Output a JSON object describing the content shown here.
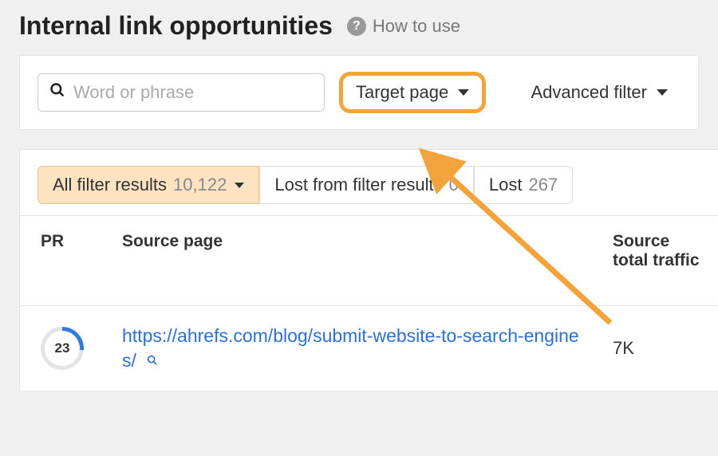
{
  "header": {
    "title": "Internal link opportunities",
    "help_label": "How to use"
  },
  "filters": {
    "search_placeholder": "Word or phrase",
    "target_dropdown_label": "Target page",
    "advanced_filter_label": "Advanced filter"
  },
  "tabs": {
    "all": {
      "label": "All filter results",
      "count": "10,122"
    },
    "lost_filter": {
      "label": "Lost from filter results",
      "count": "0"
    },
    "lost": {
      "label": "Lost",
      "count": "267"
    }
  },
  "table": {
    "columns": {
      "pr": "PR",
      "source_page": "Source page",
      "source_total_traffic": "Source total traffic"
    },
    "rows": [
      {
        "pr": "23",
        "url": "https://ahrefs.com/blog/submit-website-to-search-engines/",
        "traffic": "7K"
      }
    ]
  },
  "colors": {
    "highlight": "#f2a33c",
    "link": "#2f6fd0",
    "tab_active_bg": "#fde3c0"
  }
}
